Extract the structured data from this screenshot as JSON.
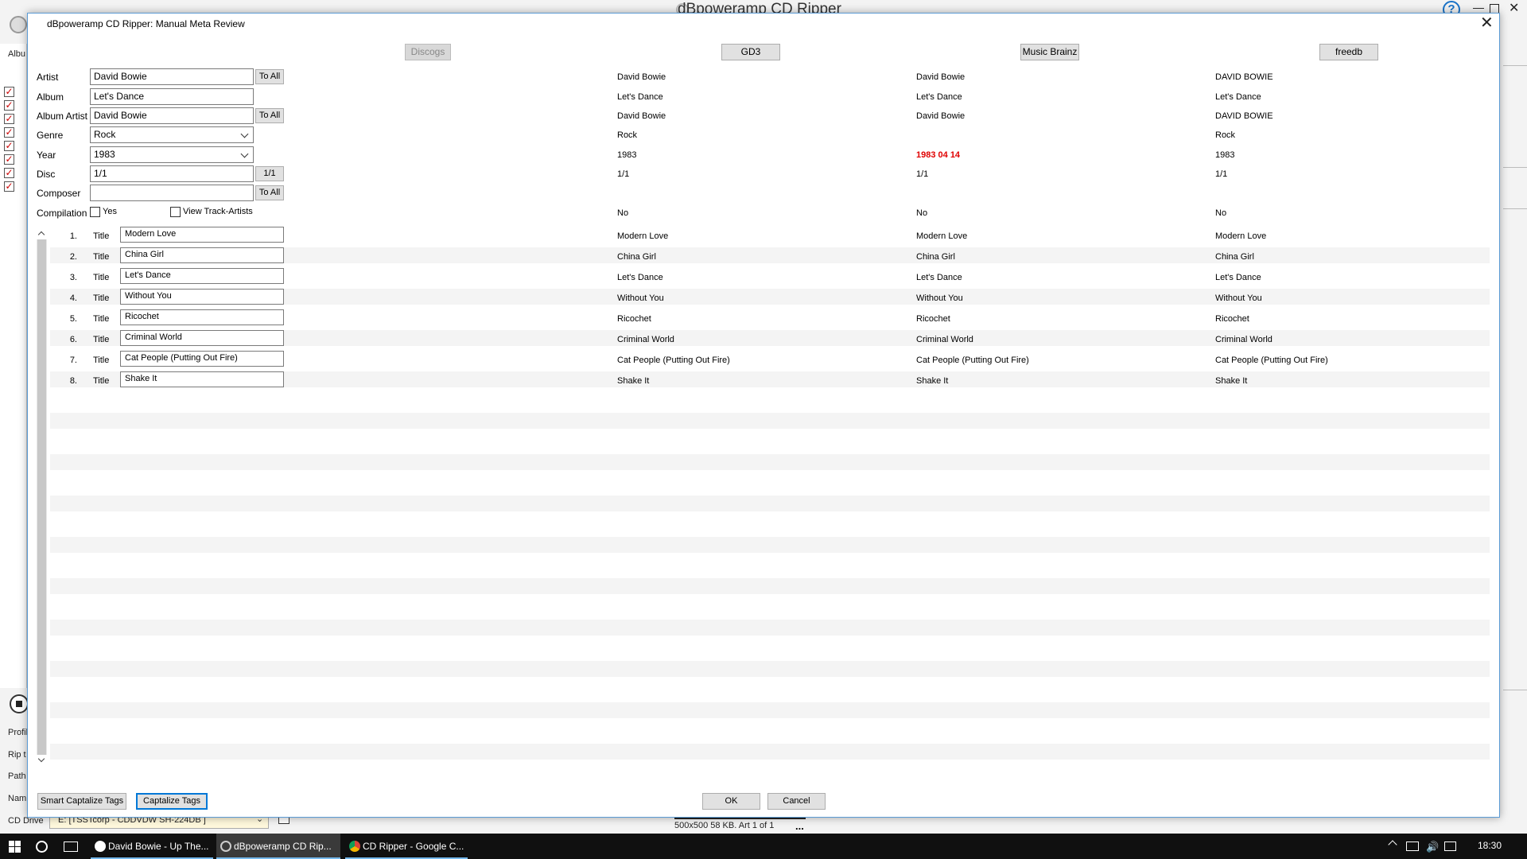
{
  "background_window": {
    "title": "dBpoweramp CD Ripper",
    "left_labels": [
      "Albu",
      "Profil",
      "Rip t",
      "Path",
      "Nami",
      "CD Drive"
    ],
    "cd_drive_value": "E:   [TSSTcorp - CDDVDW SH-224DB ]",
    "art_info": "500x500 58 KB. Art 1 of 1",
    "art_more": "..."
  },
  "dialog": {
    "title": "dBpoweramp CD Ripper: Manual Meta Review",
    "sources": [
      {
        "label": "Discogs",
        "enabled": false
      },
      {
        "label": "GD3",
        "enabled": true
      },
      {
        "label": "Music Brainz",
        "enabled": true
      },
      {
        "label": "freedb",
        "enabled": true
      }
    ],
    "fields": {
      "artist": {
        "label": "Artist",
        "value": "David Bowie",
        "button": "To All"
      },
      "album": {
        "label": "Album",
        "value": "Let's Dance"
      },
      "album_artist": {
        "label": "Album Artist",
        "value": "David Bowie",
        "button": "To All"
      },
      "genre": {
        "label": "Genre",
        "value": "Rock"
      },
      "year": {
        "label": "Year",
        "value": "1983"
      },
      "disc": {
        "label": "Disc",
        "value": "1/1",
        "button": "1/1"
      },
      "composer": {
        "label": "Composer",
        "value": "",
        "button": "To All"
      },
      "compilation": {
        "label": "Compilation",
        "yes_label": "Yes",
        "view_track_artists_label": "View Track-Artists"
      }
    },
    "columns": [
      {
        "artist": "David Bowie",
        "album": "Let's Dance",
        "album_artist": "David Bowie",
        "genre": "Rock",
        "year": "1983",
        "disc": "1/1",
        "compilation": "No",
        "tracks": [
          "Modern Love",
          "China Girl",
          "Let's Dance",
          "Without You",
          "Ricochet",
          "Criminal World",
          "Cat People (Putting Out Fire)",
          "Shake It"
        ]
      },
      {
        "artist": "David Bowie",
        "album": "Let's Dance",
        "album_artist": "David Bowie",
        "genre": "",
        "year": "1983 04 14",
        "disc": "1/1",
        "compilation": "No",
        "tracks": [
          "Modern Love",
          "China Girl",
          "Let's Dance",
          "Without You",
          "Ricochet",
          "Criminal World",
          "Cat People (Putting Out Fire)",
          "Shake It"
        ]
      },
      {
        "artist": "DAVID BOWIE",
        "album": "Let's Dance",
        "album_artist": "DAVID BOWIE",
        "genre": "Rock",
        "year": "1983",
        "disc": "1/1",
        "compilation": "No",
        "tracks": [
          "Modern Love",
          "China Girl",
          "Let's Dance",
          "Without You",
          "Ricochet",
          "Criminal World",
          "Cat People (Putting Out Fire)",
          "Shake It"
        ]
      }
    ],
    "tracks": [
      {
        "num": "1.",
        "label": "Title",
        "value": "Modern Love"
      },
      {
        "num": "2.",
        "label": "Title",
        "value": "China Girl"
      },
      {
        "num": "3.",
        "label": "Title",
        "value": "Let's Dance"
      },
      {
        "num": "4.",
        "label": "Title",
        "value": "Without You"
      },
      {
        "num": "5.",
        "label": "Title",
        "value": "Ricochet"
      },
      {
        "num": "6.",
        "label": "Title",
        "value": "Criminal World"
      },
      {
        "num": "7.",
        "label": "Title",
        "value": "Cat People (Putting Out Fire)"
      },
      {
        "num": "8.",
        "label": "Title",
        "value": "Shake It"
      }
    ],
    "buttons": {
      "smart_capitalize": "Smart Captalize Tags",
      "capitalize": "Captalize Tags",
      "ok": "OK",
      "cancel": "Cancel"
    },
    "colors": {
      "conflict": "#e00000",
      "focus": "#0078d7"
    }
  },
  "taskbar": {
    "items": [
      {
        "label": "David Bowie - Up The...",
        "state": "open"
      },
      {
        "label": "dBpoweramp CD Rip...",
        "state": "active"
      },
      {
        "label": "CD Ripper - Google C...",
        "state": "open"
      }
    ],
    "clock": "18:30"
  }
}
